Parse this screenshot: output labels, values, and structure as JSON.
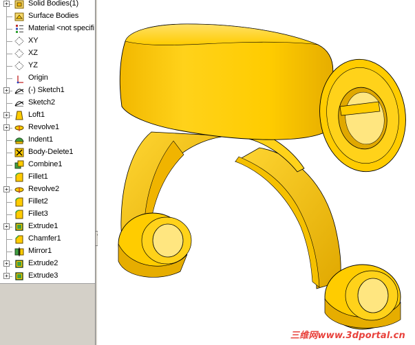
{
  "feature_tree": {
    "items": [
      {
        "label": "Solid Bodies(1)",
        "icon": "solid-bodies-folder-icon",
        "expander": "+"
      },
      {
        "label": "Surface Bodies",
        "icon": "surface-bodies-folder-icon",
        "expander": ""
      },
      {
        "label": "Material <not specifi",
        "icon": "material-icon",
        "expander": ""
      },
      {
        "label": "XY",
        "icon": "plane-icon",
        "expander": ""
      },
      {
        "label": "XZ",
        "icon": "plane-icon",
        "expander": ""
      },
      {
        "label": "YZ",
        "icon": "plane-icon",
        "expander": ""
      },
      {
        "label": "Origin",
        "icon": "origin-icon",
        "expander": ""
      },
      {
        "label": "(-) Sketch1",
        "icon": "sketch-icon",
        "expander": "+"
      },
      {
        "label": "Sketch2",
        "icon": "sketch-icon",
        "expander": ""
      },
      {
        "label": "Loft1",
        "icon": "loft-icon",
        "expander": "+"
      },
      {
        "label": "Revolve1",
        "icon": "revolve-icon",
        "expander": "+"
      },
      {
        "label": "Indent1",
        "icon": "indent-icon",
        "expander": ""
      },
      {
        "label": "Body-Delete1",
        "icon": "body-delete-icon",
        "expander": ""
      },
      {
        "label": "Combine1",
        "icon": "combine-icon",
        "expander": ""
      },
      {
        "label": "Fillet1",
        "icon": "fillet-icon",
        "expander": ""
      },
      {
        "label": "Revolve2",
        "icon": "revolve-icon",
        "expander": "+"
      },
      {
        "label": "Fillet2",
        "icon": "fillet-icon",
        "expander": ""
      },
      {
        "label": "Fillet3",
        "icon": "fillet-icon",
        "expander": ""
      },
      {
        "label": "Extrude1",
        "icon": "extrude-icon",
        "expander": "+"
      },
      {
        "label": "Chamfer1",
        "icon": "chamfer-icon",
        "expander": ""
      },
      {
        "label": "Mirror1",
        "icon": "mirror-icon",
        "expander": ""
      },
      {
        "label": "Extrude2",
        "icon": "extrude-icon",
        "expander": "+"
      },
      {
        "label": "Extrude3",
        "icon": "extrude-icon",
        "expander": "+"
      }
    ]
  },
  "splitter": {
    "handle_glyph": "‹"
  },
  "watermark": {
    "text": "三维网www.3dportal.cn"
  },
  "colors": {
    "model_fill": "#ffcc00",
    "model_shadow": "#d9a300",
    "model_highlight": "#ffe680",
    "edge": "#000000"
  }
}
